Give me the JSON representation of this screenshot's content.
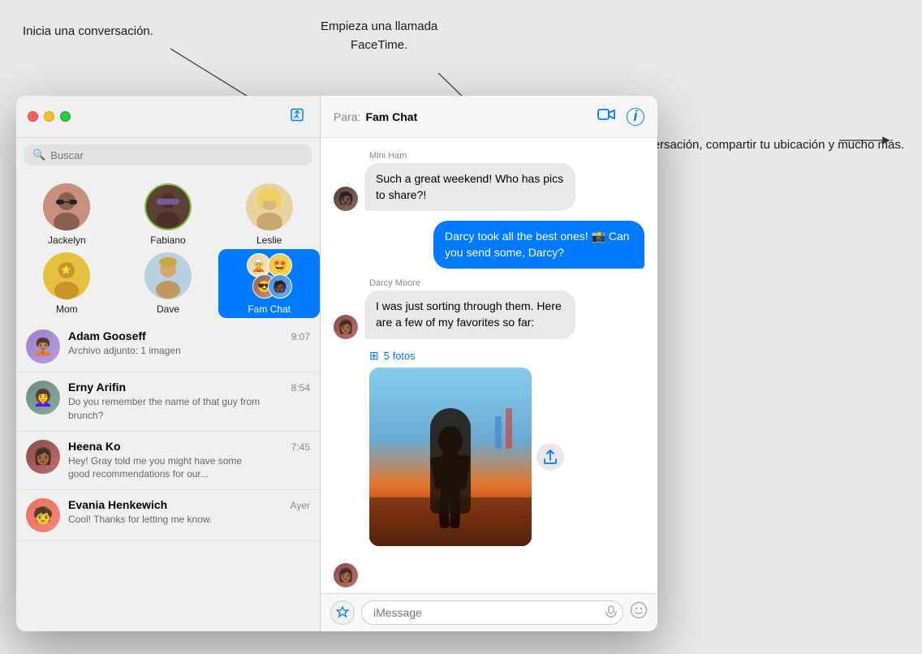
{
  "annotations": {
    "new_conversation": "Inicia una conversación.",
    "facetime": "Empieza una llamada\nFaceTime.",
    "manage": "Gestiona una\nconversación,\ncompartir tu ubicación\ny mucho más."
  },
  "sidebar": {
    "search_placeholder": "Buscar",
    "pinned": [
      {
        "id": "jackelyn",
        "name": "Jackelyn",
        "emoji": "😎"
      },
      {
        "id": "fabiano",
        "name": "Fabiano",
        "emoji": "🧑🏿"
      },
      {
        "id": "leslie",
        "name": "Leslie",
        "emoji": "🧝"
      },
      {
        "id": "mom",
        "name": "Mom",
        "emoji": "🤩"
      },
      {
        "id": "dave",
        "name": "Dave",
        "emoji": "🧔🏼"
      },
      {
        "id": "famchat",
        "name": "Fam Chat",
        "emoji": "👨‍👩‍👧"
      }
    ],
    "conversations": [
      {
        "id": "adam",
        "name": "Adam Gooseff",
        "time": "9:07",
        "preview": "Archivo adjunto: 1 imagen",
        "bold": true,
        "emoji": "🧑🏽‍🦱"
      },
      {
        "id": "erny",
        "name": "Erny Arifin",
        "time": "8:54",
        "preview": "Do you remember the name of that guy from brunch?",
        "bold": false,
        "emoji": "👩‍🦱"
      },
      {
        "id": "heena",
        "name": "Heena Ko",
        "time": "7:45",
        "preview": "Hey! Gray told me you might have some good recommendations for our...",
        "bold": false,
        "emoji": "👩🏾"
      },
      {
        "id": "evania",
        "name": "Evania Henkewich",
        "time": "Ayer",
        "preview": "Cool! Thanks for letting me know.",
        "bold": true,
        "emoji": "🧒"
      }
    ]
  },
  "chat": {
    "to_label": "Para:",
    "contact": "Fam Chat",
    "messages": [
      {
        "id": "msg1",
        "sender": "Mini Ham",
        "text": "Such a great weekend! Who has pics to share?!",
        "type": "incoming",
        "avatar_emoji": "🧑🏿"
      },
      {
        "id": "msg2",
        "sender": "You",
        "text": "Darcy took all the best ones! 📸 Can you send some, Darcy?",
        "type": "outgoing"
      },
      {
        "id": "msg3",
        "sender": "Darcy Moore",
        "text": "I was just sorting through them. Here are a few of my favorites so far:",
        "type": "incoming",
        "avatar_emoji": "👩🏾"
      }
    ],
    "photos_label": "5 fotos",
    "input_placeholder": "iMessage"
  },
  "icons": {
    "compose": "✏",
    "search": "🔍",
    "facetime": "📹",
    "info": "ℹ",
    "app": "🅰",
    "audio": "🎤",
    "emoji": "☺",
    "share": "⬆",
    "grid": "⊞"
  }
}
